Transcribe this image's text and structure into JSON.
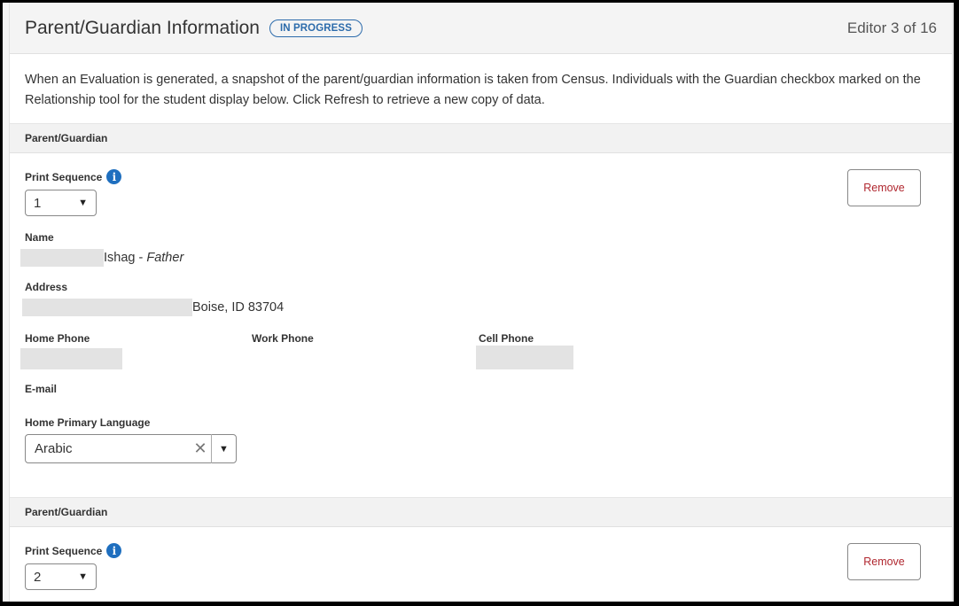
{
  "header": {
    "title": "Parent/Guardian Information",
    "status_badge": "IN PROGRESS",
    "editor_count": "Editor 3 of 16"
  },
  "intro_text": "When an Evaluation is generated, a snapshot of the parent/guardian information is taken from Census. Individuals with the Guardian checkbox marked on the Relationship tool for the student display below. Click Refresh to retrieve a new copy of data.",
  "labels": {
    "section": "Parent/Guardian",
    "print_sequence": "Print Sequence",
    "name": "Name",
    "address": "Address",
    "home_phone": "Home Phone",
    "work_phone": "Work Phone",
    "cell_phone": "Cell Phone",
    "email": "E-mail",
    "home_language": "Home Primary Language",
    "remove": "Remove",
    "info_icon": "i",
    "caret": "▼",
    "clear": "✕"
  },
  "guardians": [
    {
      "print_sequence": "1",
      "name_visible": "Ishag - ",
      "relationship": "Father",
      "address_visible": "Boise, ID 83704",
      "home_language": "Arabic"
    },
    {
      "print_sequence": "2"
    }
  ]
}
